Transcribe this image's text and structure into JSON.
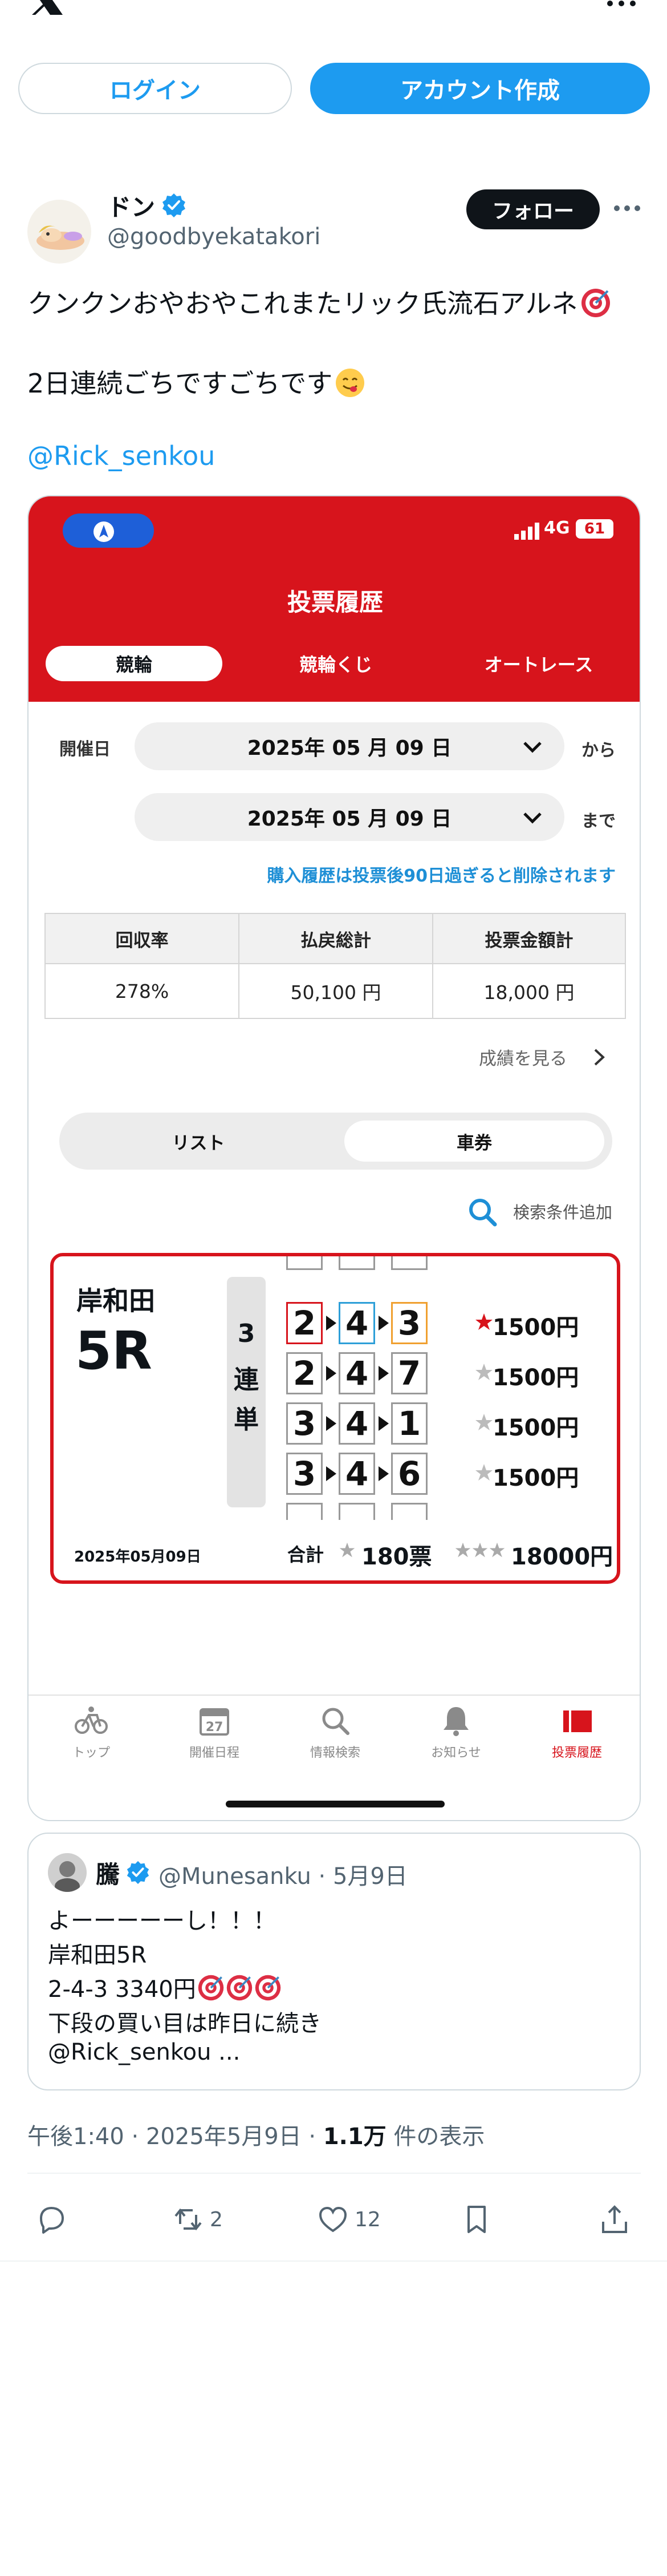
{
  "topbar": {
    "logo_icon": "x-logo-icon",
    "more_icon": "more-icon"
  },
  "auth": {
    "login": "ログイン",
    "create_account": "アカウント作成"
  },
  "tweet": {
    "author_name": "ドン",
    "author_handle": "@goodbyekatakori",
    "follow_label": "フォロー",
    "line1": "クンクンおやおやこれまたリック氏流石アルネ",
    "line2": "2日連続ごちですごちです",
    "mention": "@Rick_senkou",
    "emoji_1": "direct-hit-emoji",
    "emoji_2": "yum-face-emoji"
  },
  "media": {
    "status": {
      "network": "4G",
      "battery": "61"
    },
    "title": "投票履歴",
    "tabs": [
      "競輪",
      "競輪くじ",
      "オートレース"
    ],
    "date_label": "開催日",
    "date_from": "2025年 05 月 09 日",
    "date_to": "2025年 05 月 09 日",
    "from_label": "から",
    "to_label": "まで",
    "notice": "購入履歴は投票後90日過ぎると削除されます",
    "table": {
      "headers": [
        "回収率",
        "払戻総計",
        "投票金額計"
      ],
      "values": [
        "278%",
        "50,100 円",
        "18,000 円"
      ]
    },
    "results_link": "成績を見る",
    "segments": [
      "リスト",
      "車券"
    ],
    "search_label": "検索条件追加",
    "ticket": {
      "venue": "岸和田",
      "race": "5R",
      "bet_type_chars": [
        "3",
        "連",
        "単"
      ],
      "rows": [
        {
          "nums": [
            "2",
            "4",
            "3"
          ],
          "amount": "1500円",
          "hit": true
        },
        {
          "nums": [
            "2",
            "4",
            "7"
          ],
          "amount": "1500円",
          "hit": false
        },
        {
          "nums": [
            "3",
            "4",
            "1"
          ],
          "amount": "1500円",
          "hit": false
        },
        {
          "nums": [
            "3",
            "4",
            "6"
          ],
          "amount": "1500円",
          "hit": false
        }
      ],
      "date": "2025年05月09日",
      "total_label": "合計",
      "total_votes": "180票",
      "total_yen": "18000円"
    },
    "nav": [
      {
        "label": "トップ",
        "icon": "bicycle-icon"
      },
      {
        "label": "開催日程",
        "icon": "calendar-icon",
        "day": "27"
      },
      {
        "label": "情報検索",
        "icon": "search-icon"
      },
      {
        "label": "お知らせ",
        "icon": "bell-icon"
      },
      {
        "label": "投票履歴",
        "icon": "history-icon"
      }
    ]
  },
  "quote": {
    "name": "騰",
    "meta": "@Munesanku · 5月9日",
    "lines": [
      "よーーーーーし！！！",
      "岸和田5R",
      "2-4-3  3340円",
      "下段の買い目は昨日に続き",
      "@Rick_senkou ..."
    ]
  },
  "meta": {
    "time": "午後1:40 · 2025年5月9日 · ",
    "views": "1.1万",
    "views_label": " 件の表示"
  },
  "actions": {
    "reply": "",
    "retweets": "2",
    "likes": "12"
  },
  "colors": {
    "accent": "#1d9bf0",
    "brand_red": "#d7141c",
    "text": "#0f1419",
    "muted": "#536471"
  }
}
